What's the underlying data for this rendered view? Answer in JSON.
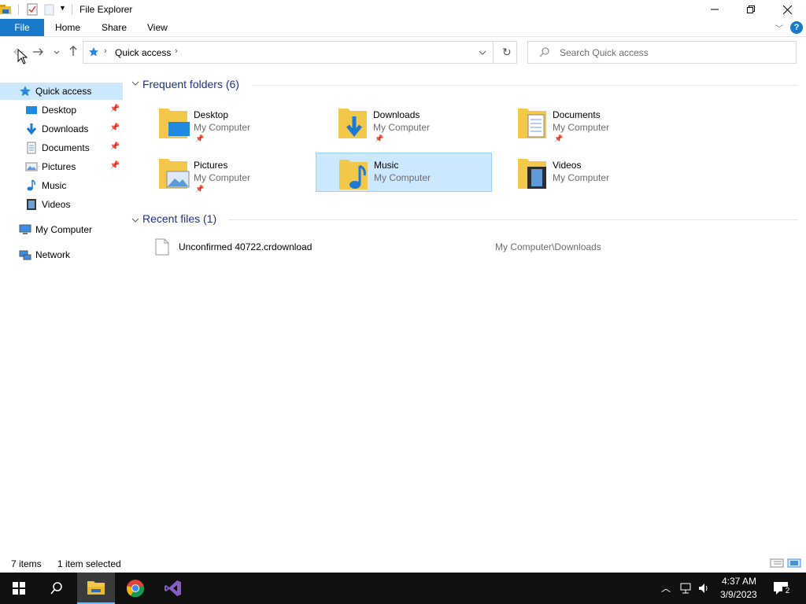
{
  "window": {
    "title": "File Explorer",
    "controls": {
      "minimize": "—",
      "restore": "❐",
      "close": "✕"
    }
  },
  "ribbon": {
    "tabs": [
      {
        "label": "File"
      },
      {
        "label": "Home"
      },
      {
        "label": "Share"
      },
      {
        "label": "View"
      }
    ],
    "help_label": "?"
  },
  "address": {
    "breadcrumb": "Quick access",
    "search_placeholder": "Search Quick access"
  },
  "sidebar": {
    "quick_access": "Quick access",
    "items": [
      {
        "label": "Desktop",
        "pinned": true
      },
      {
        "label": "Downloads",
        "pinned": true
      },
      {
        "label": "Documents",
        "pinned": true
      },
      {
        "label": "Pictures",
        "pinned": true
      },
      {
        "label": "Music",
        "pinned": false
      },
      {
        "label": "Videos",
        "pinned": false
      }
    ],
    "my_computer": "My Computer",
    "network": "Network"
  },
  "main": {
    "frequent_header": "Frequent folders (6)",
    "folders": [
      {
        "name": "Desktop",
        "location": "My Computer",
        "pinned": true
      },
      {
        "name": "Downloads",
        "location": "My Computer",
        "pinned": true
      },
      {
        "name": "Documents",
        "location": "My Computer",
        "pinned": true
      },
      {
        "name": "Pictures",
        "location": "My Computer",
        "pinned": true
      },
      {
        "name": "Music",
        "location": "My Computer",
        "pinned": false,
        "selected": true
      },
      {
        "name": "Videos",
        "location": "My Computer",
        "pinned": false
      }
    ],
    "recent_header": "Recent files (1)",
    "recent_files": [
      {
        "name": "Unconfirmed 40722.crdownload",
        "path": "My Computer\\Downloads"
      }
    ]
  },
  "status": {
    "items_count": "7 items",
    "selection": "1 item selected"
  },
  "taskbar": {
    "time": "4:37 AM",
    "date": "3/9/2023",
    "notification_count": "2"
  },
  "colors": {
    "accent": "#1979ca",
    "selection_bg": "#cce8ff",
    "selection_border": "#99d1ff",
    "group_header": "#1e3287",
    "taskbar": "#101010"
  }
}
